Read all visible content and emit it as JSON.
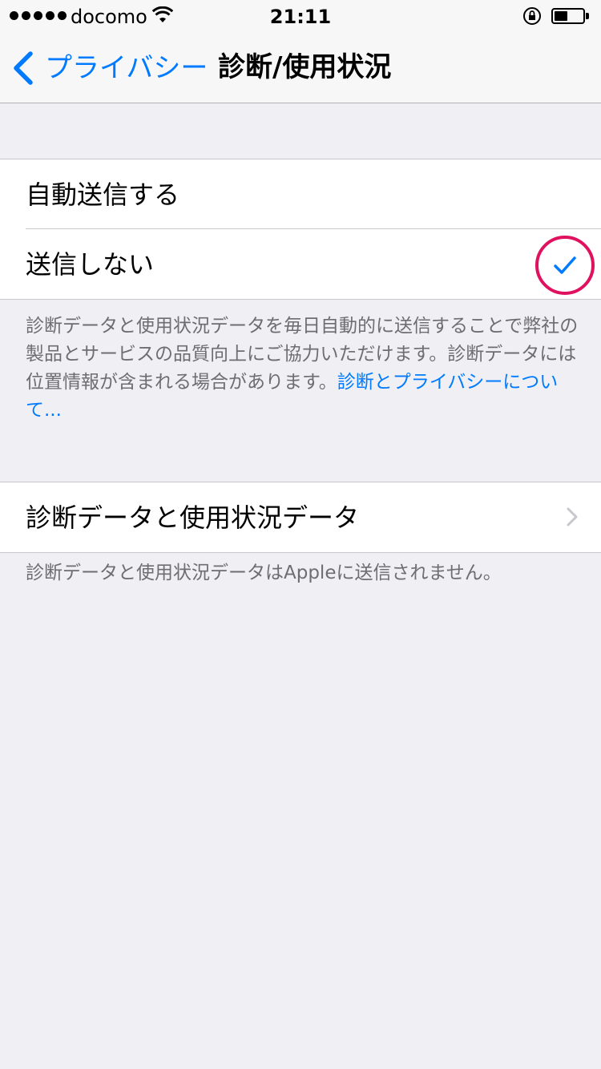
{
  "status_bar": {
    "carrier": "docomo",
    "time": "21:11"
  },
  "nav": {
    "back_label": "プライバシー",
    "title": "診断/使用状況"
  },
  "send_options": {
    "items": [
      {
        "label": "自動送信する",
        "selected": false
      },
      {
        "label": "送信しない",
        "selected": true
      }
    ],
    "footer_text": "診断データと使用状況データを毎日自動的に送信することで弊社の製品とサービスの品質向上にご協力いただけます。診断データには位置情報が含まれる場合があります。",
    "footer_link": "診断とプライバシーについて..."
  },
  "data_section": {
    "row_label": "診断データと使用状況データ",
    "footer_text": "診断データと使用状況データはAppleに送信されません。"
  },
  "colors": {
    "accent": "#007aff",
    "highlight_ring": "#e0115f",
    "background": "#efeff4"
  }
}
